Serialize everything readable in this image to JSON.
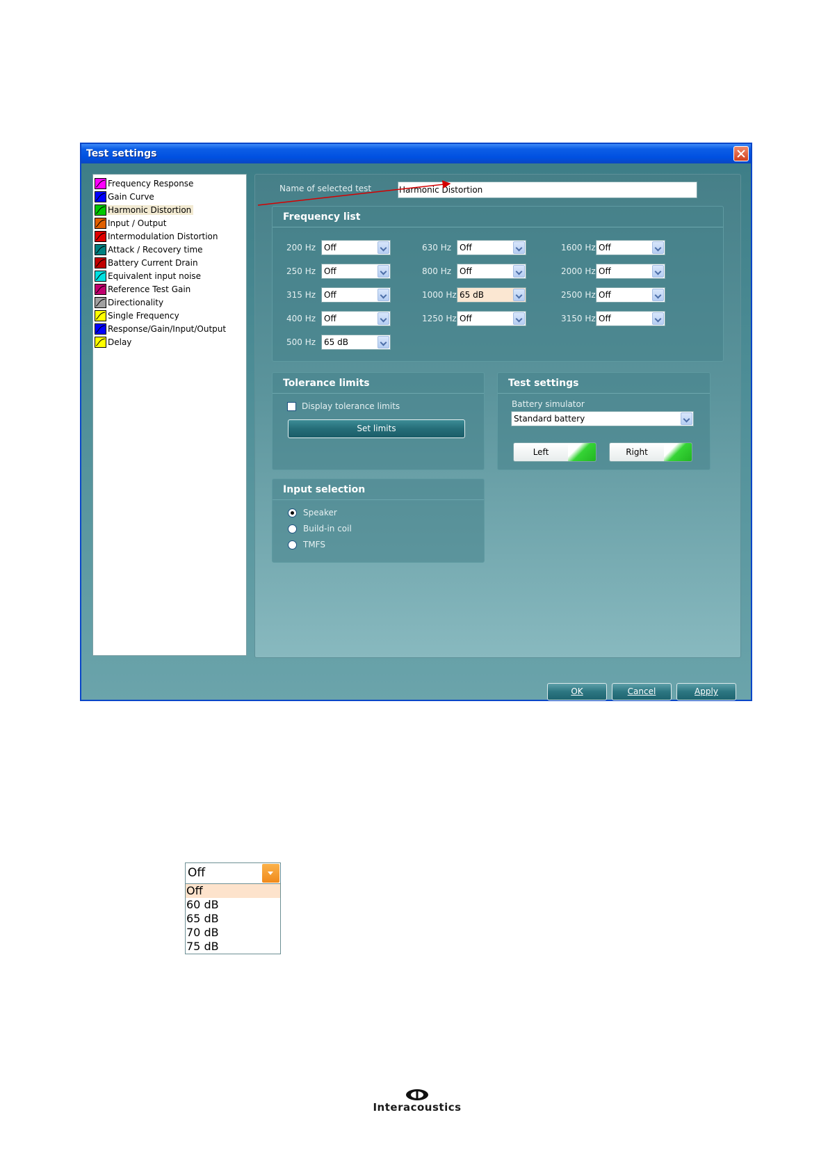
{
  "window": {
    "title": "Test settings"
  },
  "test_list": [
    {
      "label": "Frequency Response",
      "icon": "frequency-response-icon",
      "color": "#ff00ff"
    },
    {
      "label": "Gain Curve",
      "icon": "gain-curve-icon",
      "color": "#0000ff"
    },
    {
      "label": "Harmonic Distortion",
      "icon": "harmonic-distortion-icon",
      "color": "#00c800",
      "selected": true
    },
    {
      "label": "Input / Output",
      "icon": "input-output-icon",
      "color": "#e06000"
    },
    {
      "label": "Intermodulation Distortion",
      "icon": "intermodulation-distortion-icon",
      "color": "#e00000"
    },
    {
      "label": "Attack / Recovery time",
      "icon": "attack-recovery-icon",
      "color": "#008080"
    },
    {
      "label": "Battery Current Drain",
      "icon": "battery-current-drain-icon",
      "color": "#c00000"
    },
    {
      "label": "Equivalent input noise",
      "icon": "equivalent-input-noise-icon",
      "color": "#00e0e0"
    },
    {
      "label": "Reference Test Gain",
      "icon": "reference-test-gain-icon",
      "color": "#c0006e"
    },
    {
      "label": "Directionality",
      "icon": "directionality-icon",
      "color": "#a0a0a0"
    },
    {
      "label": "Single Frequency",
      "icon": "single-frequency-icon",
      "color": "#ffff00"
    },
    {
      "label": "Response/Gain/Input/Output",
      "icon": "response-gain-input-output-icon",
      "color": "#0000ff"
    },
    {
      "label": "Delay",
      "icon": "delay-icon",
      "color": "#ffff00"
    }
  ],
  "name_of_selected_test": {
    "label": "Name of selected test",
    "value": "Harmonic Distortion"
  },
  "frequency_list": {
    "title": "Frequency list",
    "columns": [
      [
        {
          "freq": "200 Hz",
          "value": "Off"
        },
        {
          "freq": "250 Hz",
          "value": "Off"
        },
        {
          "freq": "315 Hz",
          "value": "Off"
        },
        {
          "freq": "400 Hz",
          "value": "Off"
        },
        {
          "freq": "500 Hz",
          "value": "65 dB"
        }
      ],
      [
        {
          "freq": "630 Hz",
          "value": "Off"
        },
        {
          "freq": "800 Hz",
          "value": "Off"
        },
        {
          "freq": "1000 Hz",
          "value": "65 dB",
          "highlight": true
        },
        {
          "freq": "1250 Hz",
          "value": "Off"
        }
      ],
      [
        {
          "freq": "1600 Hz",
          "value": "Off"
        },
        {
          "freq": "2000 Hz",
          "value": "Off"
        },
        {
          "freq": "2500 Hz",
          "value": "Off"
        },
        {
          "freq": "3150 Hz",
          "value": "Off"
        }
      ]
    ]
  },
  "tolerance_limits": {
    "title": "Tolerance limits",
    "checkbox_label": "Display tolerance limits",
    "checked": false,
    "set_limits_label": "Set limits"
  },
  "test_settings": {
    "title": "Test settings",
    "battery_label": "Battery simulator",
    "battery_value": "Standard battery",
    "left_label": "Left",
    "right_label": "Right",
    "led_color": "#22b422"
  },
  "input_selection": {
    "title": "Input selection",
    "options": [
      "Speaker",
      "Build-in coil",
      "TMFS"
    ],
    "selected": "Speaker"
  },
  "footer_buttons": {
    "ok": "OK",
    "cancel": "Cancel",
    "apply": "Apply"
  },
  "dropdown_example": {
    "value": "Off",
    "options": [
      "Off",
      "60 dB",
      "65 dB",
      "70 dB",
      "75 dB"
    ],
    "selected": "Off"
  },
  "logo": {
    "wordmark": "Interacoustics"
  }
}
